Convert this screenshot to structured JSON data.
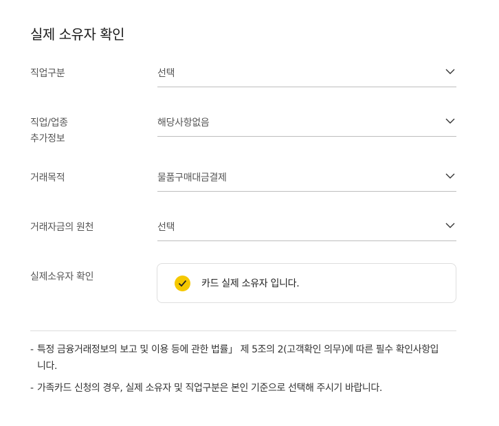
{
  "title": "실제 소유자 확인",
  "fields": [
    {
      "label": "직업구분",
      "value": "선택"
    },
    {
      "label_line1": "직업/업종",
      "label_line2": "추가정보",
      "value": "해당사항없음"
    },
    {
      "label": "거래목적",
      "value": "물품구매대금결제"
    },
    {
      "label": "거래자금의 원천",
      "value": "선택"
    }
  ],
  "confirm": {
    "label": "실제소유자 확인",
    "text": "카드 실제 소유자 입니다.",
    "checked": true,
    "check_color": "#f5c800"
  },
  "notes": [
    {
      "dash": "-",
      "text": "특정 금융거래정보의 보고 및 이용 등에 관한 법률」 제 5조의 2(고객확인 의무)에 따른 필수 확인사항입니다."
    },
    {
      "dash": "-",
      "text": "가족카드 신청의 경우, 실제 소유자 및 직업구분은 본인 기준으로 선택해 주시기 바랍니다."
    }
  ],
  "icons": {
    "dropdown": "chevron-down-icon",
    "check": "check-icon"
  }
}
